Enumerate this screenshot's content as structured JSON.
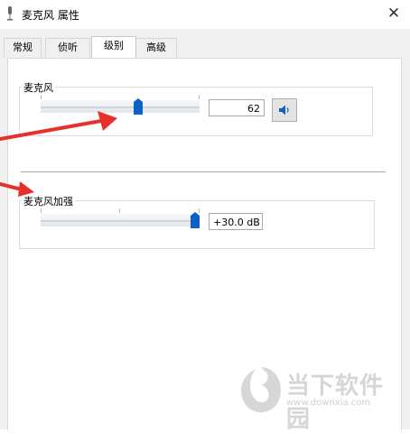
{
  "window": {
    "title": "麦克风 属性",
    "close_glyph": "✕"
  },
  "tabs": [
    {
      "label": "常规",
      "active": false
    },
    {
      "label": "侦听",
      "active": false
    },
    {
      "label": "级别",
      "active": true
    },
    {
      "label": "高级",
      "active": false
    }
  ],
  "microphone": {
    "label": "麦克风",
    "value": "62",
    "level_fraction": 0.62,
    "speaker_icon": "speaker-icon"
  },
  "boost": {
    "label": "麦克风加强",
    "value": "+30.0 dB",
    "level_fraction": 1.0
  },
  "watermark": {
    "text": "当下软件园",
    "url": "www.downxia.com"
  },
  "colors": {
    "accent": "#0a62c7",
    "arrow": "#e8302a",
    "active_tab_bg": "#ffffff"
  }
}
